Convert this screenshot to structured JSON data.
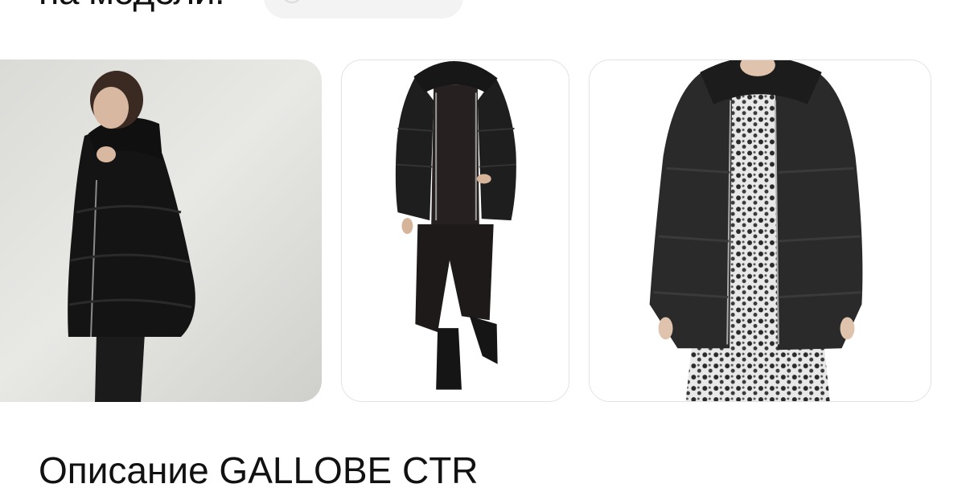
{
  "section": {
    "heading": "на модели:",
    "filter_pill": {
      "icon": "search-icon"
    }
  },
  "gallery": {
    "photos": [
      {
        "name": "model-photo-hooded-puffer-side",
        "jacket_color": "#141414"
      },
      {
        "name": "model-photo-puffer-front-full-length",
        "jacket_color": "#1e1e1e"
      },
      {
        "name": "model-photo-puffer-with-dress",
        "jacket_color": "#2a2a2a"
      }
    ]
  },
  "next_section": {
    "heading": "Описание GALLOBE CTR"
  }
}
